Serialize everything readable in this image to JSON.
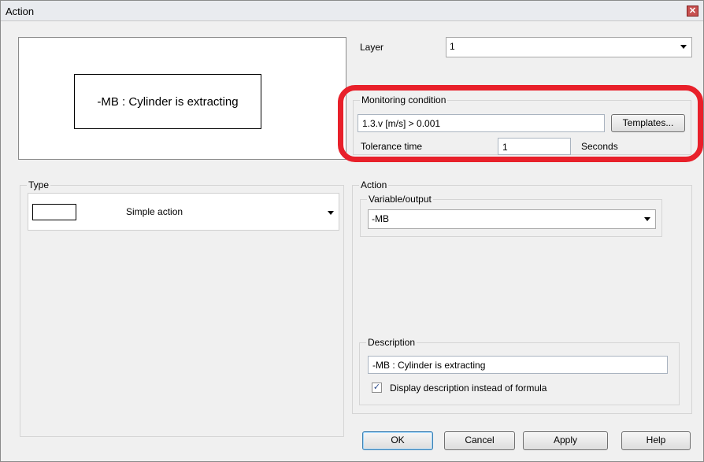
{
  "window": {
    "title": "Action",
    "close_glyph": "✕"
  },
  "preview": {
    "text": "-MB : Cylinder is extracting"
  },
  "layer": {
    "label": "Layer",
    "value": "1"
  },
  "monitoring": {
    "group_label": "Monitoring condition",
    "condition_value": "1.3.v [m/s] > 0.001",
    "templates_button": "Templates...",
    "tolerance_label": "Tolerance time",
    "tolerance_value": "1",
    "tolerance_unit": "Seconds"
  },
  "type": {
    "group_label": "Type",
    "value": "Simple action"
  },
  "action": {
    "group_label": "Action",
    "variable_label": "Variable/output",
    "variable_value": "-MB",
    "description_label": "Description",
    "description_value": "-MB : Cylinder is extracting",
    "display_checkbox_label": "Display description instead of formula",
    "display_checkbox_checked": true,
    "check_glyph": "✓"
  },
  "buttons": {
    "ok": "OK",
    "cancel": "Cancel",
    "apply": "Apply",
    "help": "Help"
  },
  "colors": {
    "highlight_ring": "#e8202a",
    "default_button_border": "#3c7fb1"
  },
  "icons": {
    "close": "close-icon",
    "dropdown": "chevron-down-icon",
    "checkmark": "checkmark-icon"
  }
}
